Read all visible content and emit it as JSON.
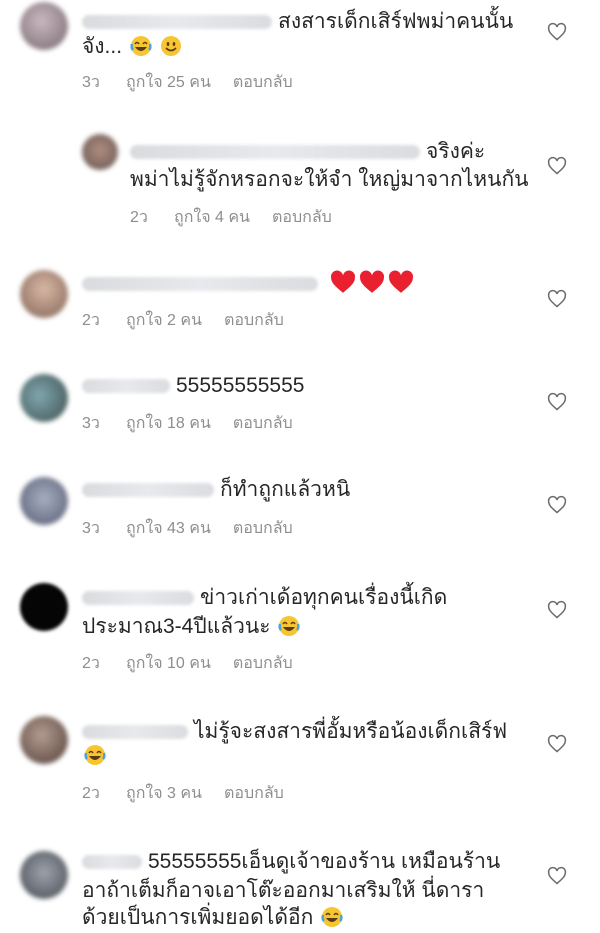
{
  "comments": [
    {
      "line1": "สงสารเด็กเสิร์ฟพม่าคนนั้น",
      "line2": "จัง...",
      "time": "3ว",
      "likes": "ถูกใจ 25 คน",
      "reply": "ตอบกลับ"
    },
    {
      "line1": "จริงค่ะ",
      "line2": "พม่าไม่รู้จักหรอกจะให้จำ ใหญ่มาจากไหนกัน",
      "time": "2ว",
      "likes": "ถูกใจ 4 คน",
      "reply": "ตอบกลับ"
    },
    {
      "time": "2ว",
      "likes": "ถูกใจ 2 คน",
      "reply": "ตอบกลับ"
    },
    {
      "line1": "55555555555",
      "time": "3ว",
      "likes": "ถูกใจ 18 คน",
      "reply": "ตอบกลับ"
    },
    {
      "line1": "ก็ทำถูกแล้วหนิ",
      "time": "3ว",
      "likes": "ถูกใจ 43 คน",
      "reply": "ตอบกลับ"
    },
    {
      "line1": "ข่าวเก่าเด้อทุกคนเรื่องนี้เกิด",
      "line2": "ประมาณ3-4ปีแล้วนะ",
      "time": "2ว",
      "likes": "ถูกใจ 10 คน",
      "reply": "ตอบกลับ"
    },
    {
      "line1": "ไม่รู้จะสงสารพี่อั้มหรือน้องเด็กเสิร์ฟ",
      "time": "2ว",
      "likes": "ถูกใจ 3 คน",
      "reply": "ตอบกลับ"
    },
    {
      "line1": "55555555เอ็นดูเจ้าของร้าน เหมือนร้าน",
      "line2": "อาถ้าเต็มก็อาจเอาโต๊ะออกมาเสริมให้  นี่ดารา",
      "line3": "ด้วยเป็นการเพิ่มยอดได้อีก"
    }
  ]
}
